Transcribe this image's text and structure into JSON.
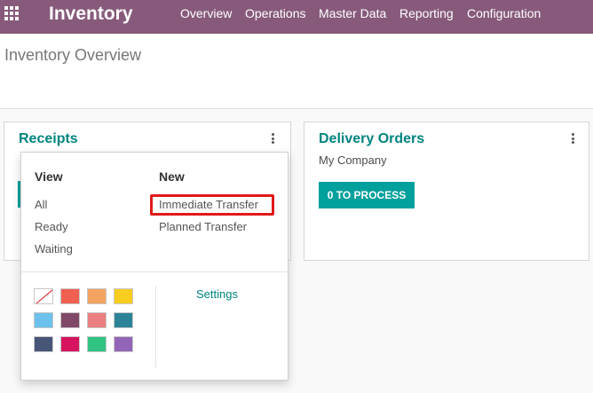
{
  "app": {
    "brand": "Inventory",
    "apps_icon": "grid-icon"
  },
  "menu": [
    "Overview",
    "Operations",
    "Master Data",
    "Reporting",
    "Configuration"
  ],
  "control_panel": {
    "title": "Inventory Overview"
  },
  "receipts_card": {
    "title": "Receipts",
    "menu_icon": "kebab-icon"
  },
  "delivery_card": {
    "title": "Delivery Orders",
    "company": "My Company",
    "process_button": "0 TO PROCESS",
    "menu_icon": "kebab-icon"
  },
  "dropdown": {
    "view_heading": "View",
    "new_heading": "New",
    "view_links": [
      "All",
      "Ready",
      "Waiting"
    ],
    "new_links": [
      "Immediate Transfer",
      "Planned Transfer"
    ],
    "highlighted": "Immediate Transfer",
    "highlight_color": "#e01a1a",
    "settings": "Settings",
    "colors": [
      "none",
      "#f06050",
      "#f4a460",
      "#f7cd1f",
      "#6cc1ed",
      "#814968",
      "#eb7e7f",
      "#2c8397",
      "#475577",
      "#d6145f",
      "#30c381",
      "#9365b8"
    ]
  },
  "theme": {
    "topbar": "#875a7b",
    "accent": "#00847f",
    "button": "#00a09d"
  }
}
